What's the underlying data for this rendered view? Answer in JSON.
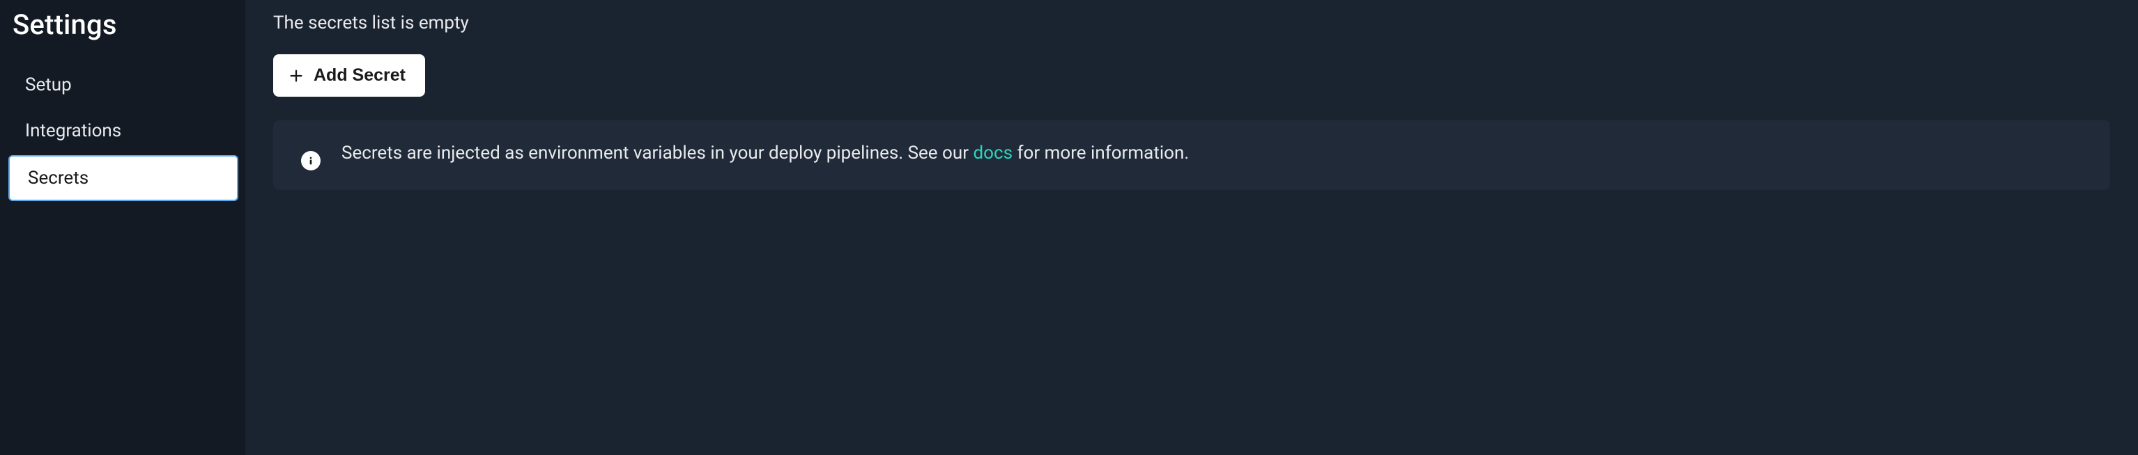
{
  "sidebar": {
    "title": "Settings",
    "items": [
      {
        "label": "Setup",
        "active": false
      },
      {
        "label": "Integrations",
        "active": false
      },
      {
        "label": "Secrets",
        "active": true
      }
    ]
  },
  "main": {
    "empty_text": "The secrets list is empty",
    "add_button_label": "Add Secret"
  },
  "info": {
    "text_before": "Secrets are injected as environment variables in your deploy pipelines. See our ",
    "link_text": "docs",
    "text_after": " for more information."
  }
}
